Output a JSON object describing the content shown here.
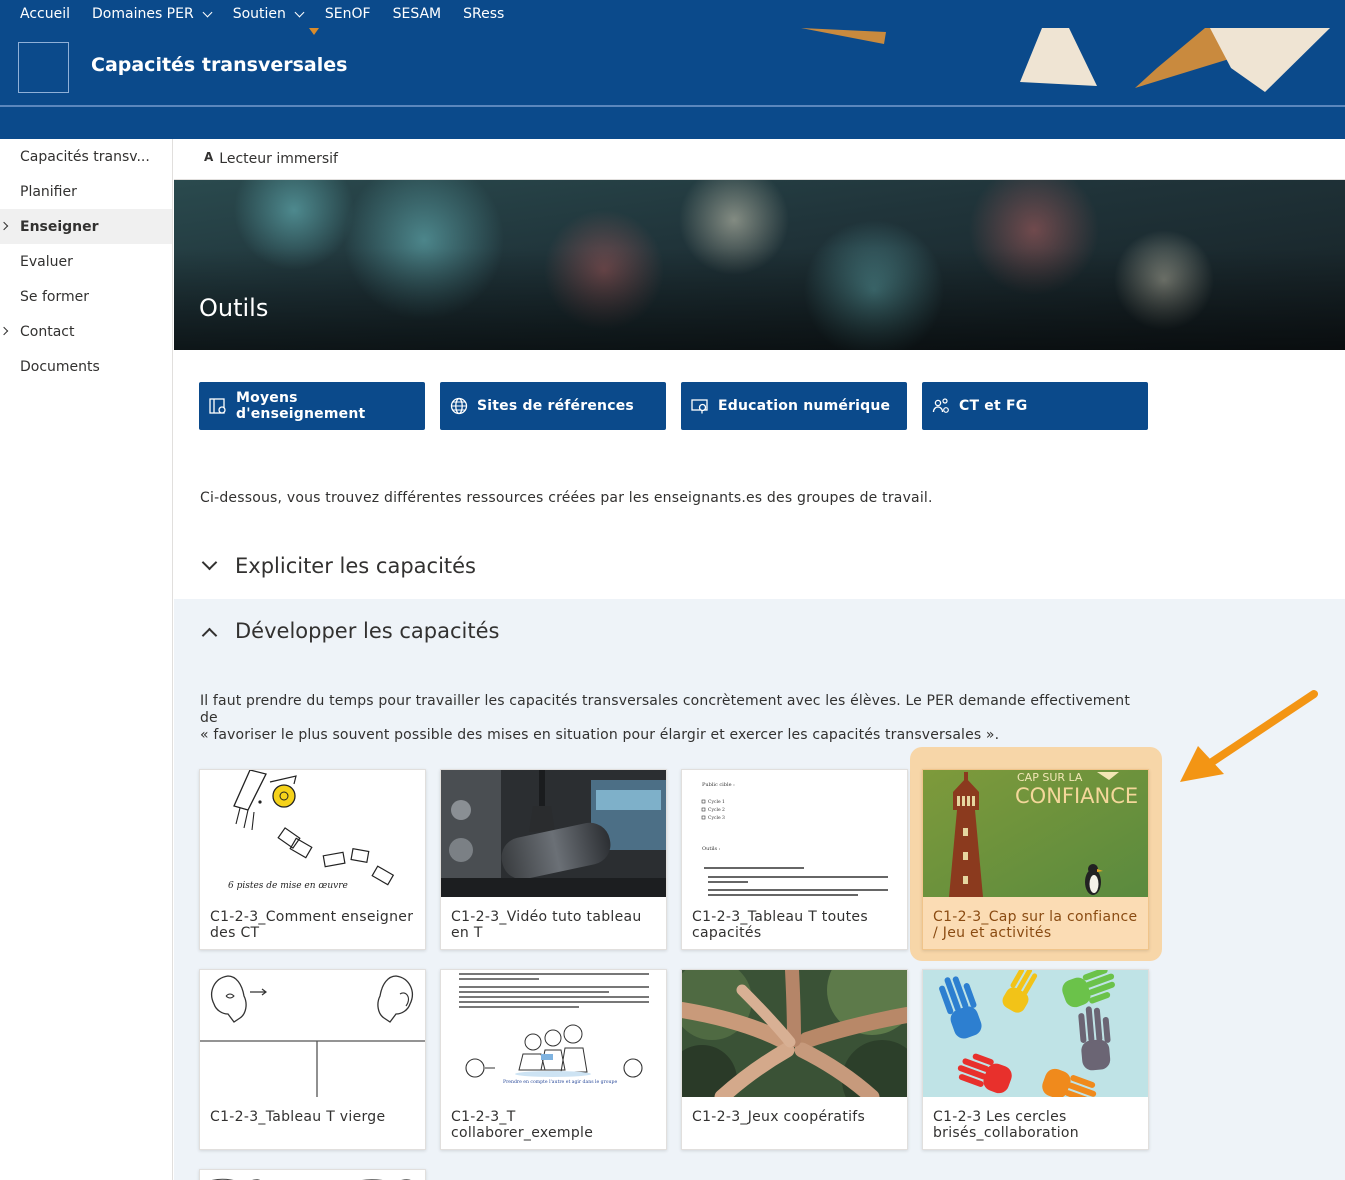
{
  "topnav": {
    "items": [
      {
        "label": "Accueil",
        "dropdown": false
      },
      {
        "label": "Domaines PER",
        "dropdown": true
      },
      {
        "label": "Soutien",
        "dropdown": true
      },
      {
        "label": "SEnOF",
        "dropdown": false
      },
      {
        "label": "SESAM",
        "dropdown": false
      },
      {
        "label": "SRess",
        "dropdown": false
      }
    ]
  },
  "site": {
    "title": "Capacités transversales"
  },
  "sidebar": {
    "items": [
      {
        "label": "Capacités transv...",
        "expandable": false,
        "active": false
      },
      {
        "label": "Planifier",
        "expandable": false,
        "active": false
      },
      {
        "label": "Enseigner",
        "expandable": true,
        "active": true
      },
      {
        "label": "Evaluer",
        "expandable": false,
        "active": false
      },
      {
        "label": "Se former",
        "expandable": false,
        "active": false
      },
      {
        "label": "Contact",
        "expandable": true,
        "active": false
      },
      {
        "label": "Documents",
        "expandable": false,
        "active": false
      }
    ]
  },
  "commandbar": {
    "immersive_label": "Lecteur immersif",
    "immersive_icon": "A"
  },
  "hero": {
    "title": "Outils"
  },
  "quicklinks": [
    {
      "label": "Moyens d'enseignement",
      "icon": "book-icon"
    },
    {
      "label": "Sites de références",
      "icon": "globe-icon"
    },
    {
      "label": "Education numérique",
      "icon": "screen-icon"
    },
    {
      "label": "CT et FG",
      "icon": "people-icon"
    }
  ],
  "intro": "Ci-dessous, vous trouvez différentes ressources créées par les enseignants.es des groupes de travail.",
  "sections": {
    "explicit": {
      "title": "Expliciter les capacités",
      "expanded": false
    },
    "develop": {
      "title": "Développer les capacités",
      "expanded": true,
      "paragraph_line1": "Il faut prendre du temps pour travailler les capacités transversales concrètement avec les élèves. Le PER demande effectivement de",
      "paragraph_line2": "« favoriser le plus souvent possible des mises en situation pour élargir et exercer les capacités transversales »."
    }
  },
  "cards": [
    {
      "title": "C1-2-3_Comment enseigner des CT",
      "thumb_caption": "6 pistes de mise en œuvre"
    },
    {
      "title": "C1-2-3_Vidéo tuto tableau en T"
    },
    {
      "title": "C1-2-3_Tableau T toutes capacités",
      "thumb_lines": [
        "Public cible :",
        "Cycle 1",
        "Cycle 2",
        "Cycle 3",
        "Outils :"
      ]
    },
    {
      "title": "C1-2-3_Cap sur la confiance / Jeu et activités",
      "thumb_line1": "CAP SUR LA",
      "thumb_line2": "CONFIANCE",
      "highlighted": true
    },
    {
      "title": "C1-2-3_Tableau T vierge"
    },
    {
      "title": "C1-2-3_T collaborer_exemple",
      "thumb_caption": "Prendre en compte l'autre et agir dans le groupe"
    },
    {
      "title": "C1-2-3_Jeux coopératifs"
    },
    {
      "title": "C1-2-3 Les cercles brisés_collaboration"
    }
  ],
  "colors": {
    "brand": "#0b4a8b",
    "highlight": "#f7d6a8",
    "arrow": "#f39514"
  }
}
